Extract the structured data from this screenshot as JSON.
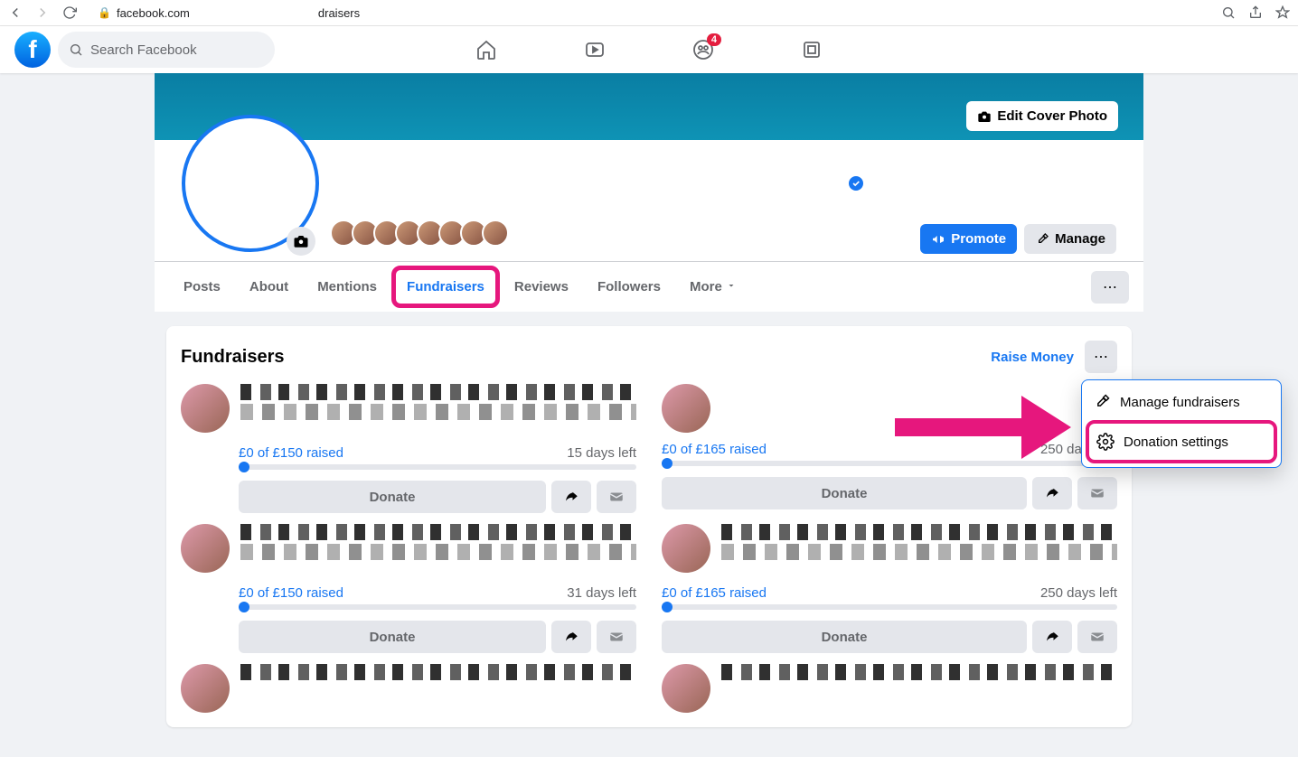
{
  "browser": {
    "url_host": "facebook.com",
    "url_path_suffix": "draisers"
  },
  "topnav": {
    "search_placeholder": "Search Facebook",
    "notification_count": "4"
  },
  "cover": {
    "edit_label": "Edit Cover Photo"
  },
  "actions": {
    "promote": "Promote",
    "manage": "Manage"
  },
  "tabs": {
    "posts": "Posts",
    "about": "About",
    "mentions": "Mentions",
    "fundraisers": "Fundraisers",
    "reviews": "Reviews",
    "followers": "Followers",
    "more": "More"
  },
  "section": {
    "title": "Fundraisers",
    "raise_money": "Raise Money",
    "donate": "Donate"
  },
  "fundraisers": [
    {
      "raised": "£0 of £150 raised",
      "days": "15 days left"
    },
    {
      "raised": "£0 of £165 raised",
      "days": "250 days left"
    },
    {
      "raised": "£0 of £150 raised",
      "days": "31 days left"
    },
    {
      "raised": "£0 of £165 raised",
      "days": "250 days left"
    }
  ],
  "dropdown": {
    "manage": "Manage fundraisers",
    "donation": "Donation settings"
  }
}
